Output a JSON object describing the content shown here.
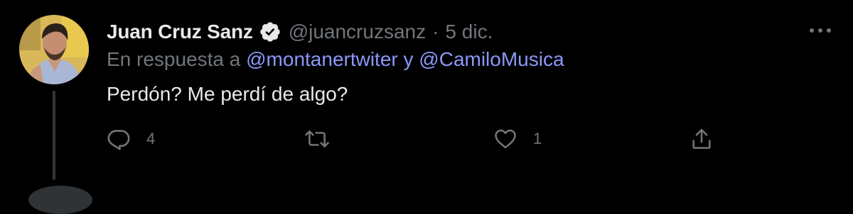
{
  "tweet": {
    "author_name": "Juan Cruz Sanz",
    "verified_icon": "verified-badge-icon",
    "handle": "@juancruzsanz",
    "separator": "·",
    "timestamp": "5 dic.",
    "reply_prefix": "En respuesta a",
    "reply_to_1": "@montanertwiter",
    "reply_conjunction": "y",
    "reply_to_2": "@CamiloMusica",
    "text": "Perdón? Me perdí de algo?",
    "more_icon": "more-options-icon"
  },
  "actions": {
    "reply": {
      "icon": "reply-icon",
      "count": "4"
    },
    "retweet": {
      "icon": "retweet-icon",
      "count": ""
    },
    "like": {
      "icon": "heart-icon",
      "count": "1"
    },
    "share": {
      "icon": "share-icon"
    }
  },
  "colors": {
    "background": "#000000",
    "primary_text": "#e7e9ea",
    "secondary_text": "#71767b",
    "mention": "#8b98f9",
    "thread_line": "#333639"
  }
}
